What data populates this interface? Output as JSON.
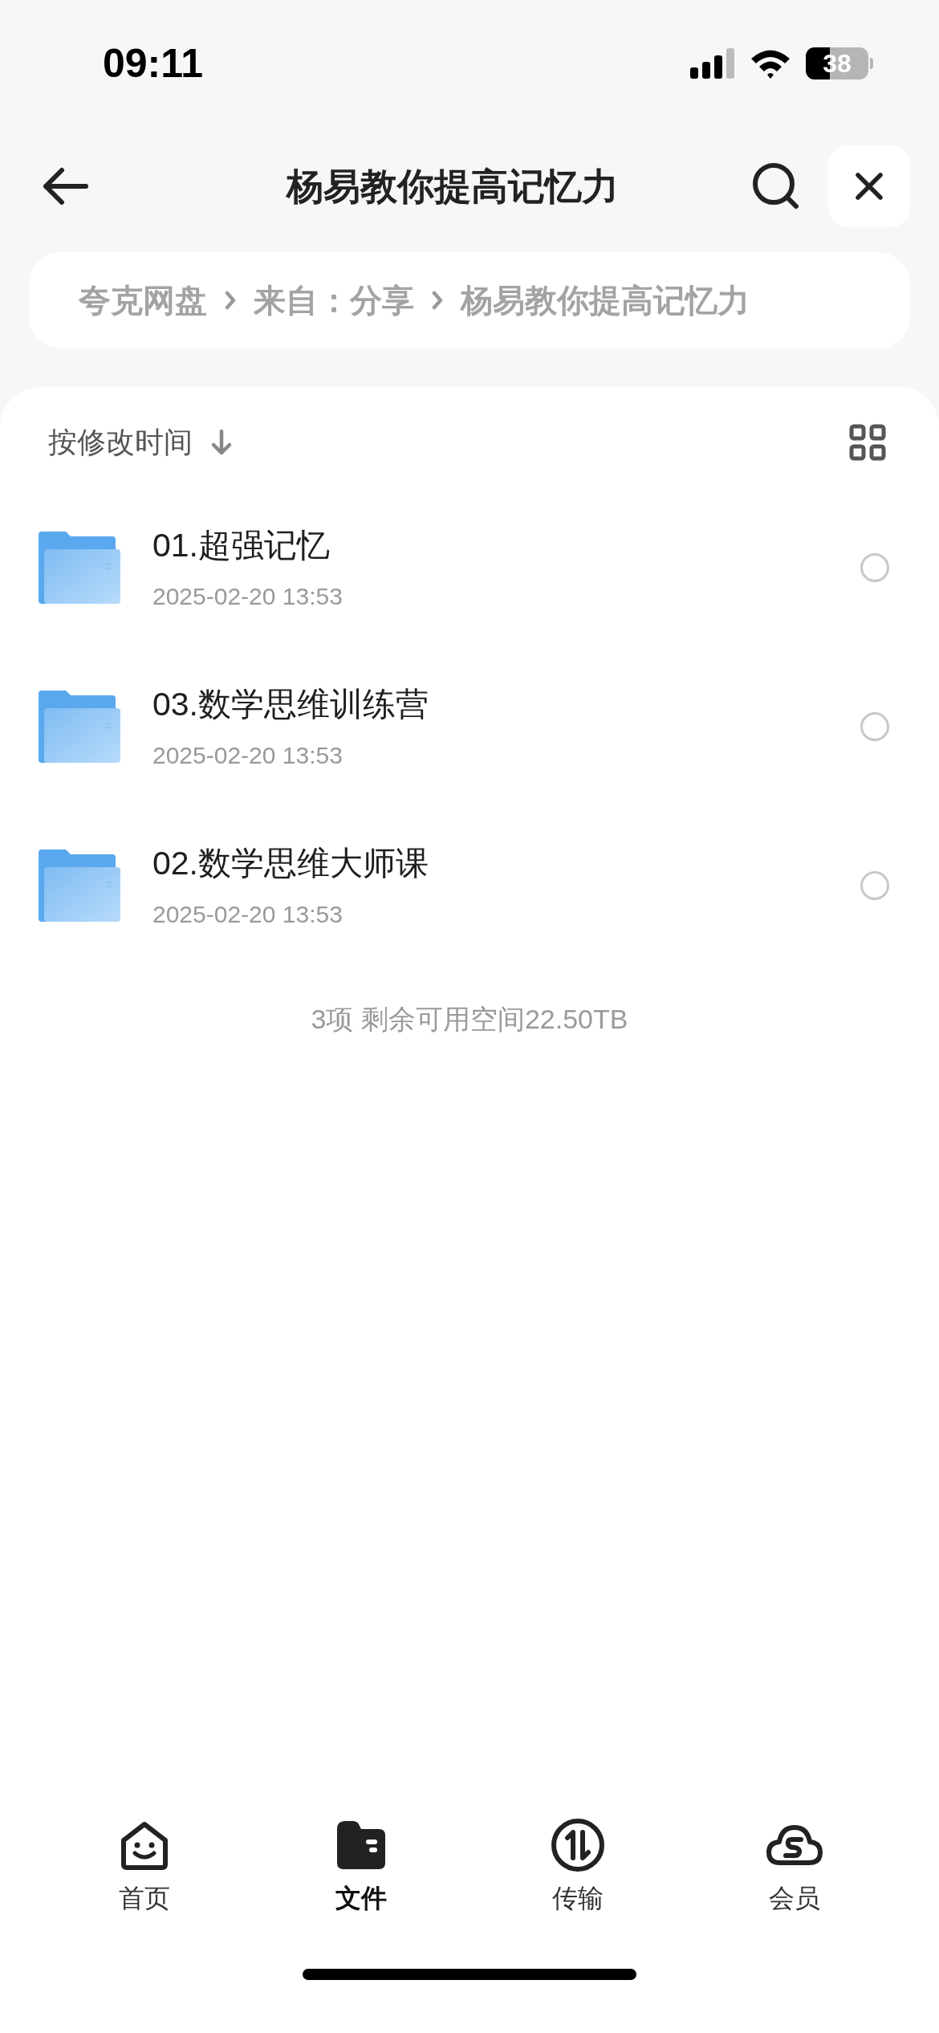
{
  "status_bar": {
    "time": "09:11",
    "battery": "38"
  },
  "header": {
    "title": "杨易教你提高记忆力"
  },
  "breadcrumb": [
    "夸克网盘",
    "来自：分享",
    "杨易教你提高记忆力"
  ],
  "sort": {
    "label": "按修改时间"
  },
  "files": [
    {
      "name": "01.超强记忆",
      "date": "2025-02-20 13:53",
      "selected": false
    },
    {
      "name": "03.数学思维训练营",
      "date": "2025-02-20 13:53",
      "selected": false
    },
    {
      "name": "02.数学思维大师课",
      "date": "2025-02-20 13:53",
      "selected": false
    }
  ],
  "footer": "3项 剩余可用空间22.50TB",
  "tabs": [
    {
      "label": "首页",
      "selected": false
    },
    {
      "label": "文件",
      "selected": true
    },
    {
      "label": "传输",
      "selected": false
    },
    {
      "label": "会员",
      "selected": false
    }
  ]
}
